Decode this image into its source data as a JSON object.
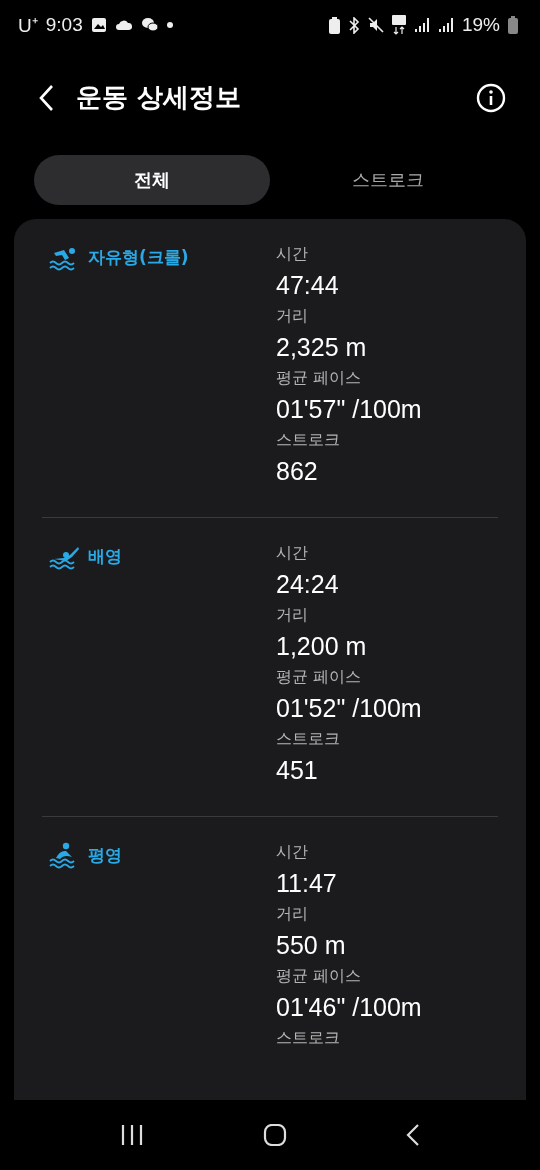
{
  "status_bar": {
    "carrier": "U⁺",
    "time": "9:03",
    "battery": "19%"
  },
  "header": {
    "title": "운동 상세정보"
  },
  "tabs": [
    {
      "label": "전체",
      "selected": true
    },
    {
      "label": "스트로크",
      "selected": false
    }
  ],
  "sections": [
    {
      "name": "자유형(크롤)",
      "kind": "freestyle",
      "stats": [
        {
          "label": "시간",
          "value": "47:44"
        },
        {
          "label": "거리",
          "value": "2,325 m"
        },
        {
          "label": "평균 페이스",
          "value": "01'57\" /100m"
        },
        {
          "label": "스트로크",
          "value": "862"
        }
      ]
    },
    {
      "name": "배영",
      "kind": "backstroke",
      "stats": [
        {
          "label": "시간",
          "value": "24:24"
        },
        {
          "label": "거리",
          "value": "1,200 m"
        },
        {
          "label": "평균 페이스",
          "value": "01'52\" /100m"
        },
        {
          "label": "스트로크",
          "value": "451"
        }
      ]
    },
    {
      "name": "평영",
      "kind": "breaststroke",
      "stats": [
        {
          "label": "시간",
          "value": "11:47"
        },
        {
          "label": "거리",
          "value": "550 m"
        },
        {
          "label": "평균 페이스",
          "value": "01'46\" /100m"
        },
        {
          "label": "스트로크"
        }
      ]
    }
  ]
}
